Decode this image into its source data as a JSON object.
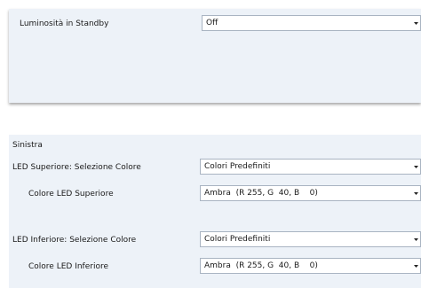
{
  "standby": {
    "label": "Luminosità in Standby",
    "value": "Off"
  },
  "section": {
    "title": "Sinistra"
  },
  "led_superiore": {
    "selection_label": "LED Superiore: Selezione Colore",
    "selection_value": "Colori Predefiniti",
    "color_label": "Colore LED Superiore",
    "color_value": "Ambra  (R 255, G  40, B    0)"
  },
  "led_inferiore": {
    "selection_label": "LED Inferiore: Selezione Colore",
    "selection_value": "Colori Predefiniti",
    "color_label": "Colore LED Inferiore",
    "color_value": "Ambra  (R 255, G  40, B    0)"
  },
  "icons": {
    "dropdown_arrow": "chevron-down-icon"
  }
}
